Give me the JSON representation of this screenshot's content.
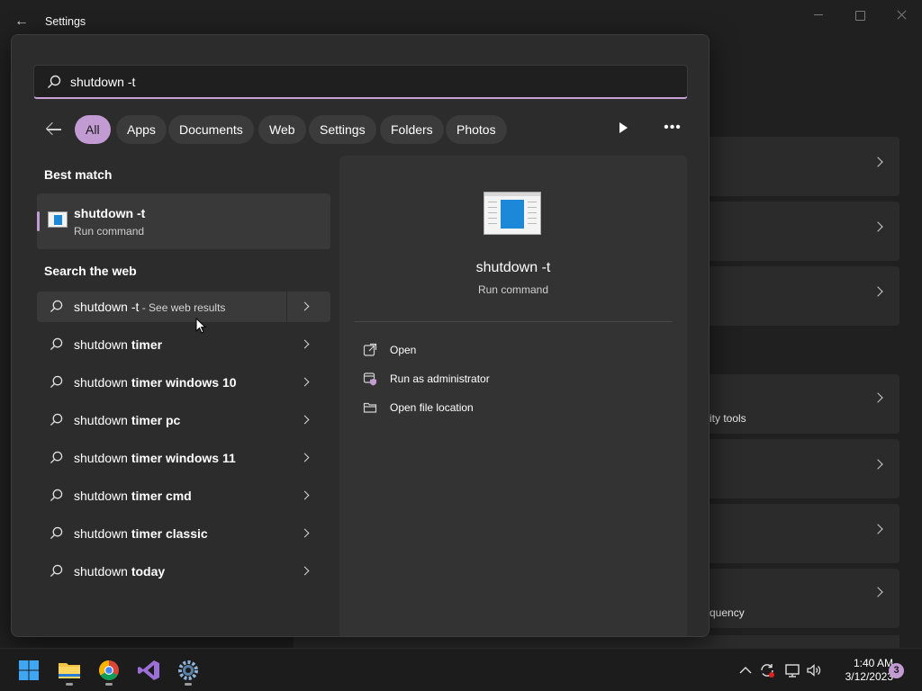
{
  "window": {
    "title": "Settings",
    "back_icon": "arrow-left-icon",
    "background_items": [
      {
        "text": ""
      },
      {
        "text": ""
      },
      {
        "text": ""
      },
      {
        "text": "ity tools"
      },
      {
        "text": ""
      },
      {
        "text": ""
      },
      {
        "text": "quency"
      }
    ]
  },
  "search": {
    "value": "shutdown -t",
    "icon": "search-icon",
    "accent": "#c39bd3"
  },
  "filters": {
    "items": [
      "All",
      "Apps",
      "Documents",
      "Web",
      "Settings",
      "Folders",
      "Photos"
    ],
    "active": "All"
  },
  "best_match": {
    "heading": "Best match",
    "title": "shutdown -t",
    "subtitle": "Run command"
  },
  "web": {
    "heading": "Search the web",
    "first": {
      "query": "shutdown -t",
      "suffix": " - See web results"
    },
    "suggestions": [
      {
        "prefix": "shutdown ",
        "bold": "timer"
      },
      {
        "prefix": "shutdown ",
        "bold": "timer windows 10"
      },
      {
        "prefix": "shutdown ",
        "bold": "timer pc"
      },
      {
        "prefix": "shutdown ",
        "bold": "timer windows 11"
      },
      {
        "prefix": "shutdown ",
        "bold": "timer cmd"
      },
      {
        "prefix": "shutdown ",
        "bold": "timer classic"
      },
      {
        "prefix": "shutdown ",
        "bold": "today"
      }
    ]
  },
  "preview": {
    "title": "shutdown -t",
    "subtitle": "Run command",
    "actions": [
      {
        "label": "Open",
        "icon": "open-external-icon"
      },
      {
        "label": "Run as administrator",
        "icon": "shield-admin-icon"
      },
      {
        "label": "Open file location",
        "icon": "folder-icon"
      }
    ]
  },
  "taskbar": {
    "time": "1:40 AM",
    "date": "3/12/2023",
    "notification_count": "3"
  }
}
